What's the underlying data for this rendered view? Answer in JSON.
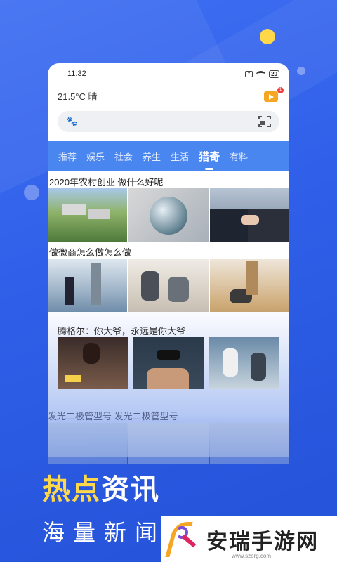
{
  "status": {
    "time": "11:32",
    "battery": "20"
  },
  "weather": {
    "text": "21.5°C 晴"
  },
  "tabs": [
    {
      "label": "推荐"
    },
    {
      "label": "娱乐"
    },
    {
      "label": "社会"
    },
    {
      "label": "养生"
    },
    {
      "label": "生活"
    },
    {
      "label": "猎奇",
      "active": true
    },
    {
      "label": "有料"
    }
  ],
  "articles": [
    {
      "title": "2020年农村创业 做什么好呢"
    },
    {
      "title": "做微商怎么做怎么做"
    },
    {
      "title": "腾格尔：你大爷，永远是你大爷"
    },
    {
      "title": "发光二极管型号 发光二极管型号"
    }
  ],
  "promo": {
    "title_part1": "热点",
    "title_part2": "资讯",
    "subtitle": "海量新闻"
  },
  "watermark": {
    "text": "安瑞手游网",
    "url": "www.szerg.com"
  },
  "colors": {
    "background": "#2f5fe8",
    "tab_bar": "#4a86f0",
    "accent_yellow": "#ffd84a"
  }
}
